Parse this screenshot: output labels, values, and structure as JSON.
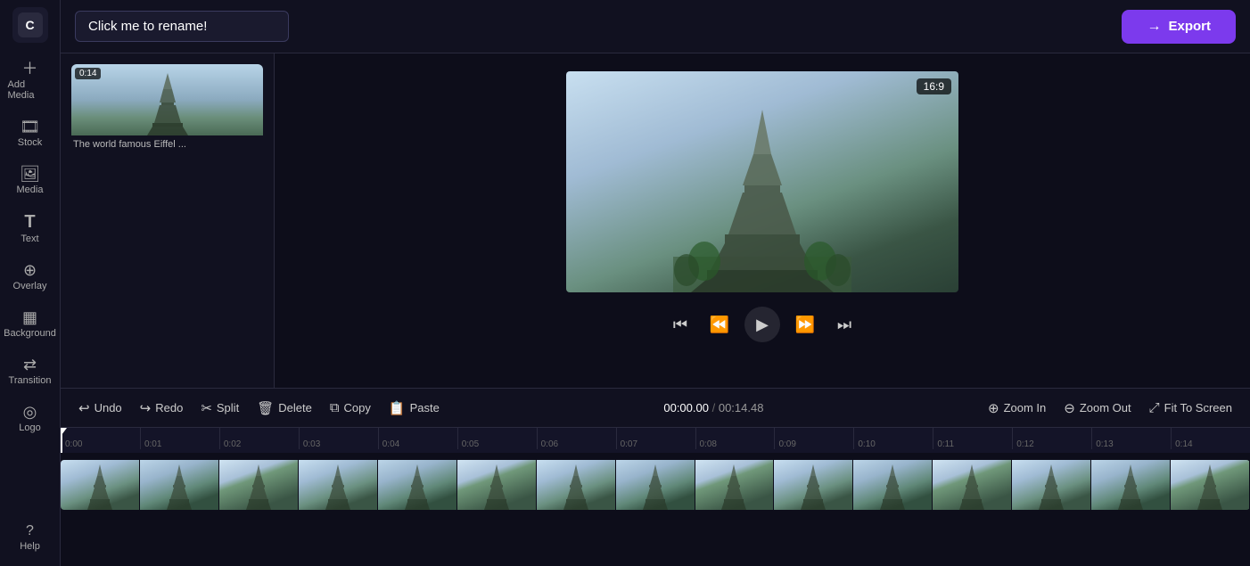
{
  "app": {
    "logo": "C",
    "project_name": "Click me to rename!"
  },
  "sidebar": {
    "items": [
      {
        "id": "add-media",
        "icon": "＋",
        "label": "Add Media"
      },
      {
        "id": "stock",
        "icon": "🎞",
        "label": "Stock"
      },
      {
        "id": "media",
        "icon": "🖼",
        "label": "Media"
      },
      {
        "id": "text",
        "icon": "T",
        "label": "Text"
      },
      {
        "id": "overlay",
        "icon": "⊕",
        "label": "Overlay"
      },
      {
        "id": "background",
        "icon": "▦",
        "label": "Background"
      },
      {
        "id": "transition",
        "icon": "⇄",
        "label": "Transition"
      },
      {
        "id": "logo",
        "icon": "◎",
        "label": "Logo"
      },
      {
        "id": "help",
        "icon": "?",
        "label": "Help"
      }
    ]
  },
  "topbar": {
    "export_label": "Export",
    "export_icon": "→"
  },
  "media_panel": {
    "item": {
      "duration": "0:14",
      "title": "The world famous Eiffel ..."
    }
  },
  "preview": {
    "aspect_ratio": "16:9"
  },
  "toolbar": {
    "undo_label": "Undo",
    "redo_label": "Redo",
    "split_label": "Split",
    "delete_label": "Delete",
    "copy_label": "Copy",
    "paste_label": "Paste",
    "zoom_in_label": "Zoom In",
    "zoom_out_label": "Zoom Out",
    "fit_to_screen_label": "Fit To Screen",
    "time_current": "00:00.00",
    "time_separator": "/",
    "time_total": "00:14.48"
  },
  "timeline": {
    "ruler_marks": [
      "0:00",
      "0:01",
      "0:02",
      "0:03",
      "0:04",
      "0:05",
      "0:06",
      "0:07",
      "0:08",
      "0:09",
      "0:10",
      "0:11",
      "0:12",
      "0:13",
      "0:14"
    ]
  }
}
